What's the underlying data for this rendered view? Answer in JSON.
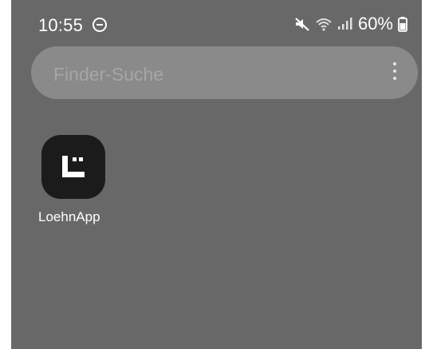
{
  "status_bar": {
    "time": "10:55",
    "battery": "60%",
    "icons": [
      "do-not-disturb-icon",
      "mute-icon",
      "wifi-icon",
      "signal-icon",
      "battery-icon"
    ]
  },
  "search": {
    "placeholder": "Finder-Suche",
    "menu_icon": "more-vert-icon"
  },
  "apps": [
    {
      "label": "LoehnApp",
      "icon": "loehnapp-icon"
    }
  ],
  "colors": {
    "background": "#686868",
    "search_bar": "#8a8a8a",
    "app_icon_bg": "#1b1b1b",
    "text": "#ffffff"
  }
}
